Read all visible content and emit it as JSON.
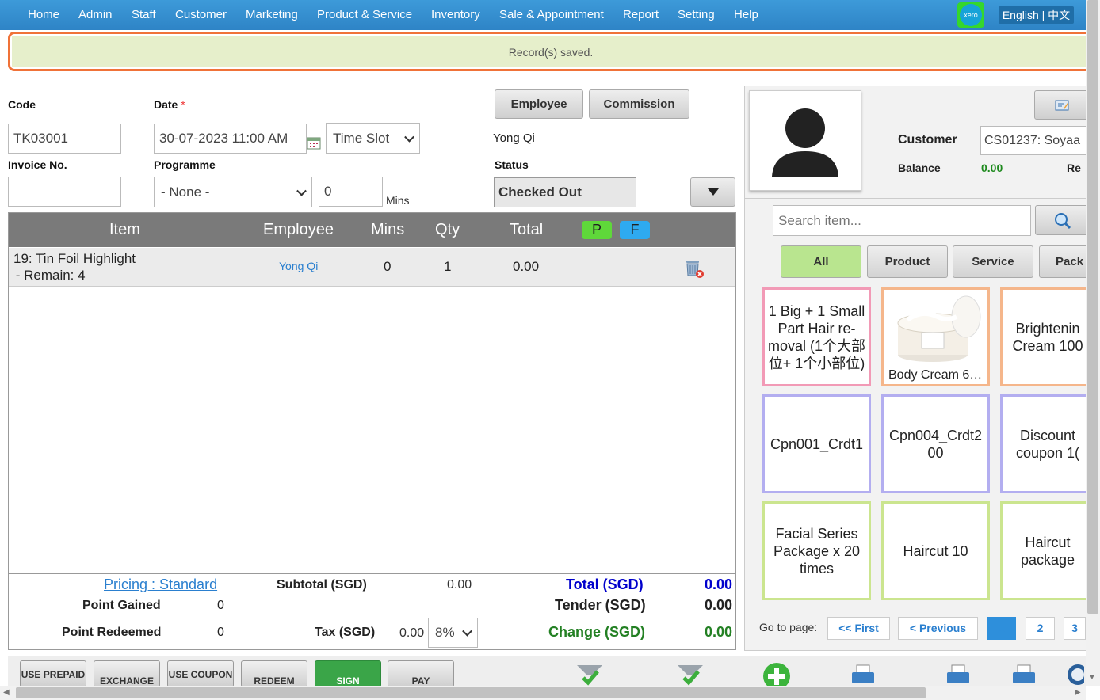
{
  "nav": {
    "items": [
      "Home",
      "Admin",
      "Staff",
      "Customer",
      "Marketing",
      "Product & Service",
      "Inventory",
      "Sale & Appointment",
      "Report",
      "Setting",
      "Help"
    ],
    "xero_label": "xero",
    "language": "English | 中文"
  },
  "flash": {
    "message": "Record(s) saved."
  },
  "form": {
    "code_label": "Code",
    "code_value": "TK03001",
    "date_label": "Date",
    "date_required": "*",
    "date_value": "30-07-2023 11:00 AM",
    "timeslot": "Time Slot",
    "invoice_label": "Invoice No.",
    "invoice_value": "",
    "programme_label": "Programme",
    "programme_value": "- None -",
    "mins_value": "0",
    "mins_label": "Mins",
    "employee_btn": "Employee",
    "commission_btn": "Commission",
    "employee_name": "Yong Qi",
    "status_label": "Status",
    "status_value": "Checked Out"
  },
  "table": {
    "headers": [
      "Item",
      "Employee",
      "Mins",
      "Qty",
      "Total"
    ],
    "p_label": "P",
    "f_label": "F",
    "rows": [
      {
        "item": "19: Tin Foil Highlight",
        "remain": " - Remain: 4",
        "employee": "Yong Qi",
        "mins": "0",
        "qty": "1",
        "total": "0.00"
      }
    ]
  },
  "totals": {
    "pricing": "Pricing : Standard",
    "subtotal_label": "Subtotal (SGD)",
    "subtotal_value": "0.00",
    "total_label": "Total (SGD)",
    "total_value": "0.00",
    "point_gained_label": "Point Gained",
    "point_gained_value": "0",
    "tender_label": "Tender (SGD)",
    "tender_value": "0.00",
    "point_redeemed_label": "Point Redeemed",
    "point_redeemed_value": "0",
    "tax_label": "Tax (SGD)",
    "tax_value": "0.00",
    "tax_rate": "8%",
    "change_label": "Change (SGD)",
    "change_value": "0.00"
  },
  "customer": {
    "label": "Customer",
    "value": "CS01237: Soyaa",
    "balance_label": "Balance",
    "balance_value": "0.00",
    "re_label": "Re"
  },
  "search": {
    "placeholder": "Search item..."
  },
  "tabs": [
    "All",
    "Product",
    "Service",
    "Pack"
  ],
  "tiles": [
    {
      "label": "1 Big + 1 Small Part Hair re-moval (1个大部位+ 1个小部位)",
      "border": "#f29ab6"
    },
    {
      "label": "Body Cream 6…",
      "border": "#f5b68b",
      "image": "cream-jar"
    },
    {
      "label": "Brightenin Cream 100",
      "border": "#f5b68b"
    },
    {
      "label": "Cpn001_Crdt1",
      "border": "#b3aef0"
    },
    {
      "label": "Cpn004_Crdt2 00",
      "border": "#b3aef0"
    },
    {
      "label": "Discount coupon 1(",
      "border": "#b3aef0"
    },
    {
      "label": "Facial Series Package x 20 times",
      "border": "#cbe58f"
    },
    {
      "label": "Haircut 10",
      "border": "#cbe58f"
    },
    {
      "label": "Haircut package",
      "border": "#cbe58f"
    }
  ],
  "pagination": {
    "goto_label": "Go to page:",
    "first": "<< First",
    "previous": "< Previous",
    "pages": [
      "1",
      "2",
      "3"
    ],
    "current": "1"
  },
  "bottom_buttons": [
    "USE PREPAID",
    "EXCHANGE",
    "USE COUPON",
    "REDEEM",
    "SIGN",
    "PAY"
  ],
  "colors": {
    "nav_bg": "#2e84c6",
    "flash_border": "#f07238",
    "flash_bg": "#e6efcb",
    "total_blue": "#0000cc",
    "change_green": "#238023",
    "balance_green": "#1e8a1e",
    "p_pill": "#5fd83a",
    "f_pill": "#2eaaf0",
    "all_tab": "#b9e58f",
    "sign_btn": "#3aa548"
  }
}
